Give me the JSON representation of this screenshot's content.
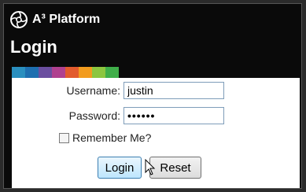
{
  "brand": {
    "name": "A³ Platform",
    "logo_icon": "aperture-logo-icon"
  },
  "page": {
    "title": "Login"
  },
  "color_strip": [
    "#2a8fbf",
    "#1e6fb0",
    "#6b4fa0",
    "#b0408f",
    "#e25b2d",
    "#f29c1f",
    "#8cc63f",
    "#3fae49"
  ],
  "form": {
    "username_label": "Username:",
    "username_value": "justin",
    "password_label": "Password:",
    "password_value": "••••••",
    "remember_label": "Remember Me?",
    "remember_checked": false,
    "login_label": "Login",
    "reset_label": "Reset"
  }
}
